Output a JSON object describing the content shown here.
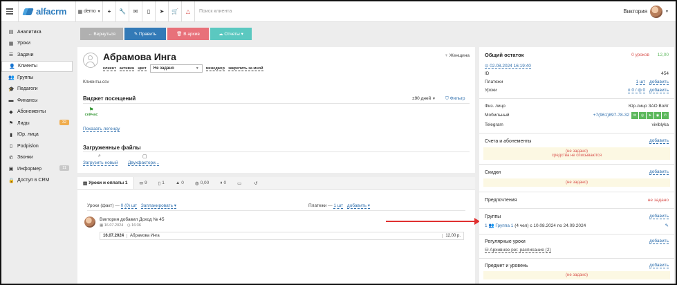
{
  "header": {
    "logo_text": "alfacrm",
    "branch": "demo",
    "search_placeholder": "Поиск клиента",
    "user_name": "Виктория"
  },
  "sidebar": {
    "items": [
      {
        "label": "Аналитика",
        "icon": "dashboard-icon"
      },
      {
        "label": "Уроки",
        "icon": "calendar-icon"
      },
      {
        "label": "Задачи",
        "icon": "tasks-icon"
      },
      {
        "label": "Клиенты",
        "icon": "user-icon",
        "active": true
      },
      {
        "label": "Группы",
        "icon": "users-icon"
      },
      {
        "label": "Педагоги",
        "icon": "graduation-cap-icon"
      },
      {
        "label": "Финансы",
        "icon": "money-icon"
      },
      {
        "label": "Абонементы",
        "icon": "tag-icon"
      },
      {
        "label": "Лиды",
        "icon": "leads-icon",
        "badge": "32",
        "badge_color": "#f0ad4e"
      },
      {
        "label": "Юр. лица",
        "icon": "briefcase-icon"
      },
      {
        "label": "Podpislon",
        "icon": "document-icon"
      },
      {
        "label": "Звонки",
        "icon": "phone-icon"
      },
      {
        "label": "Информер",
        "icon": "informer-icon",
        "badge": "11",
        "badge_color": "#c8c8c8"
      },
      {
        "label": "Доступ в CRM",
        "icon": "lock-icon"
      }
    ]
  },
  "actions": {
    "back": "← Вернуться",
    "edit": "✎ Править",
    "archive": "🗑 В архив",
    "reports": "☁ Отчеты ▾"
  },
  "colors": {
    "back": "#b0b0b0",
    "edit": "#337ab7",
    "archive": "#e8717a",
    "reports": "#5bc8c0",
    "link": "#2f6fad",
    "danger": "#d9534f",
    "success": "#5cb85c"
  },
  "client": {
    "name": "Абрамова Инга",
    "gender": "Женщина",
    "tags": [
      "клиент",
      "активен",
      "цвет"
    ],
    "status_select": "Не задано",
    "tags_after": [
      "менеджер",
      "закрепить за мной"
    ],
    "file": "Клиенты.csv",
    "widget_title": "Виджет посещений",
    "widget_period": "±90 дней",
    "widget_filter": "Фильтр",
    "widget_now": "сейчас",
    "widget_legend": "Показать легенду",
    "files_title": "Загруженные файлы",
    "upload_new": "Загрузить новый",
    "two_factor": "Двухфактори..."
  },
  "tabs": [
    {
      "label": "Уроки и оплаты 1",
      "icon": "list-icon",
      "active": true
    },
    {
      "label": "9",
      "icon": "comments-icon"
    },
    {
      "label": "1",
      "icon": "document-icon"
    },
    {
      "label": "0",
      "icon": "chart-icon"
    },
    {
      "label": "0,00",
      "icon": "coins-icon"
    },
    {
      "label": "0",
      "icon": "pause-icon"
    },
    {
      "label": "",
      "icon": "card-icon"
    },
    {
      "label": "",
      "icon": "history-icon"
    }
  ],
  "lessons": {
    "fact_label": "Уроки (факт) —",
    "fact_link": "0 (0) шт",
    "plan_link": "Запланировать ▾",
    "payments_label": "Платежи —",
    "payments_link": "1 шт",
    "payments_add": "добавить ▾",
    "entry_title": "Виктория добавил Доход № 45",
    "entry_date": "16.07.2024",
    "entry_time": "16:36",
    "entry_row_date": "16.07.2024",
    "entry_row_name": "Абрамова Инга",
    "entry_row_amount": "12,00 р."
  },
  "right": {
    "balance_title": "Общий остаток",
    "balance_lessons": "0 уроков",
    "balance_money": "12,00",
    "balance_date": "02.08.2024 16:19:40",
    "id_label": "ID",
    "id_value": "454",
    "payments_label": "Платежи",
    "payments_value": "1 шт",
    "payments_add": "добавить",
    "lessons_label": "Уроки",
    "lessons_value": "п 0 / ф 0",
    "lessons_add": "добавить",
    "phys_label": "Физ. лицо",
    "phys_value": "Юр.лицо ЗАО Войт",
    "mobile_label": "Мобильный",
    "mobile_value": "+7(961)897-78-32",
    "telegram_label": "Telegram",
    "telegram_value": "viviblyka",
    "accounts_title": "Счета и абонементы",
    "add": "добавить",
    "not_set": "(не задано)",
    "not_deducted": "средства не списываются",
    "discounts_title": "Скидки",
    "prefs_title": "Предпочтения",
    "prefs_value": "не задано",
    "groups_title": "Группы",
    "group_count": "1",
    "group_name": "Группа 1",
    "group_info": "(4 чел) с 10.08.2024 по 24.09.2024",
    "regular_title": "Регулярные уроки",
    "regular_archive": "Архивное рег. расписание (2)",
    "subject_title": "Предмет и уровень"
  }
}
